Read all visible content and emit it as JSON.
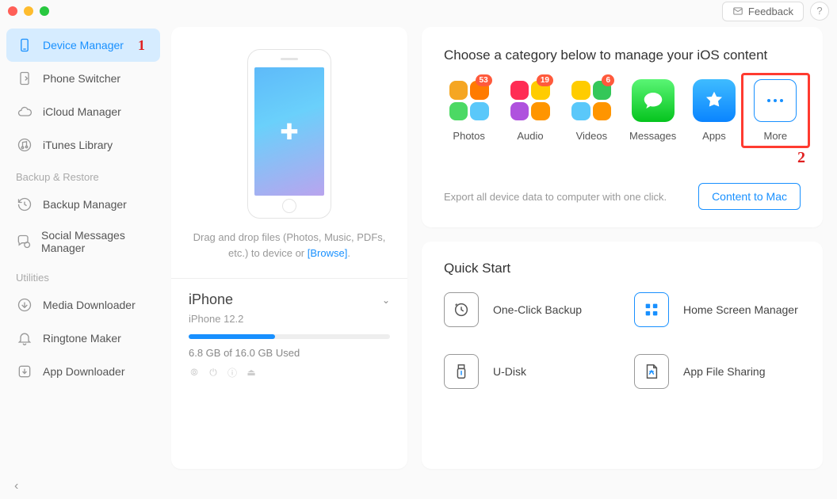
{
  "titlebar": {
    "feedback_label": "Feedback",
    "help_label": "?"
  },
  "sidebar": {
    "items": [
      {
        "label": "Device Manager"
      },
      {
        "label": "Phone Switcher"
      },
      {
        "label": "iCloud Manager"
      },
      {
        "label": "iTunes Library"
      }
    ],
    "section_backup": "Backup & Restore",
    "backup_items": [
      {
        "label": "Backup Manager"
      },
      {
        "label": "Social Messages Manager"
      }
    ],
    "section_utilities": "Utilities",
    "utility_items": [
      {
        "label": "Media Downloader"
      },
      {
        "label": "Ringtone Maker"
      },
      {
        "label": "App Downloader"
      }
    ]
  },
  "annotations": {
    "step1": "1",
    "step2": "2"
  },
  "device_panel": {
    "drop_text_line1": "Drag and drop files (Photos, Music, PDFs,",
    "drop_text_line2": "etc.) to device or ",
    "browse_label": "[Browse]",
    "dot": ".",
    "name": "iPhone",
    "os": "iPhone 12.2",
    "storage_used_pct": 43,
    "storage_text": "6.8 GB of  16.0 GB Used"
  },
  "category": {
    "title": "Choose a category below to manage your iOS content",
    "items": [
      {
        "label": "Photos",
        "badge": "53"
      },
      {
        "label": "Audio",
        "badge": "19"
      },
      {
        "label": "Videos",
        "badge": "6"
      },
      {
        "label": "Messages"
      },
      {
        "label": "Apps"
      },
      {
        "label": "More"
      }
    ],
    "export_text": "Export all device data to computer with one click.",
    "content_to_mac_label": "Content to Mac"
  },
  "quickstart": {
    "title": "Quick Start",
    "items": [
      {
        "label": "One-Click Backup"
      },
      {
        "label": "Home Screen Manager"
      },
      {
        "label": "U-Disk"
      },
      {
        "label": "App File Sharing"
      }
    ]
  }
}
